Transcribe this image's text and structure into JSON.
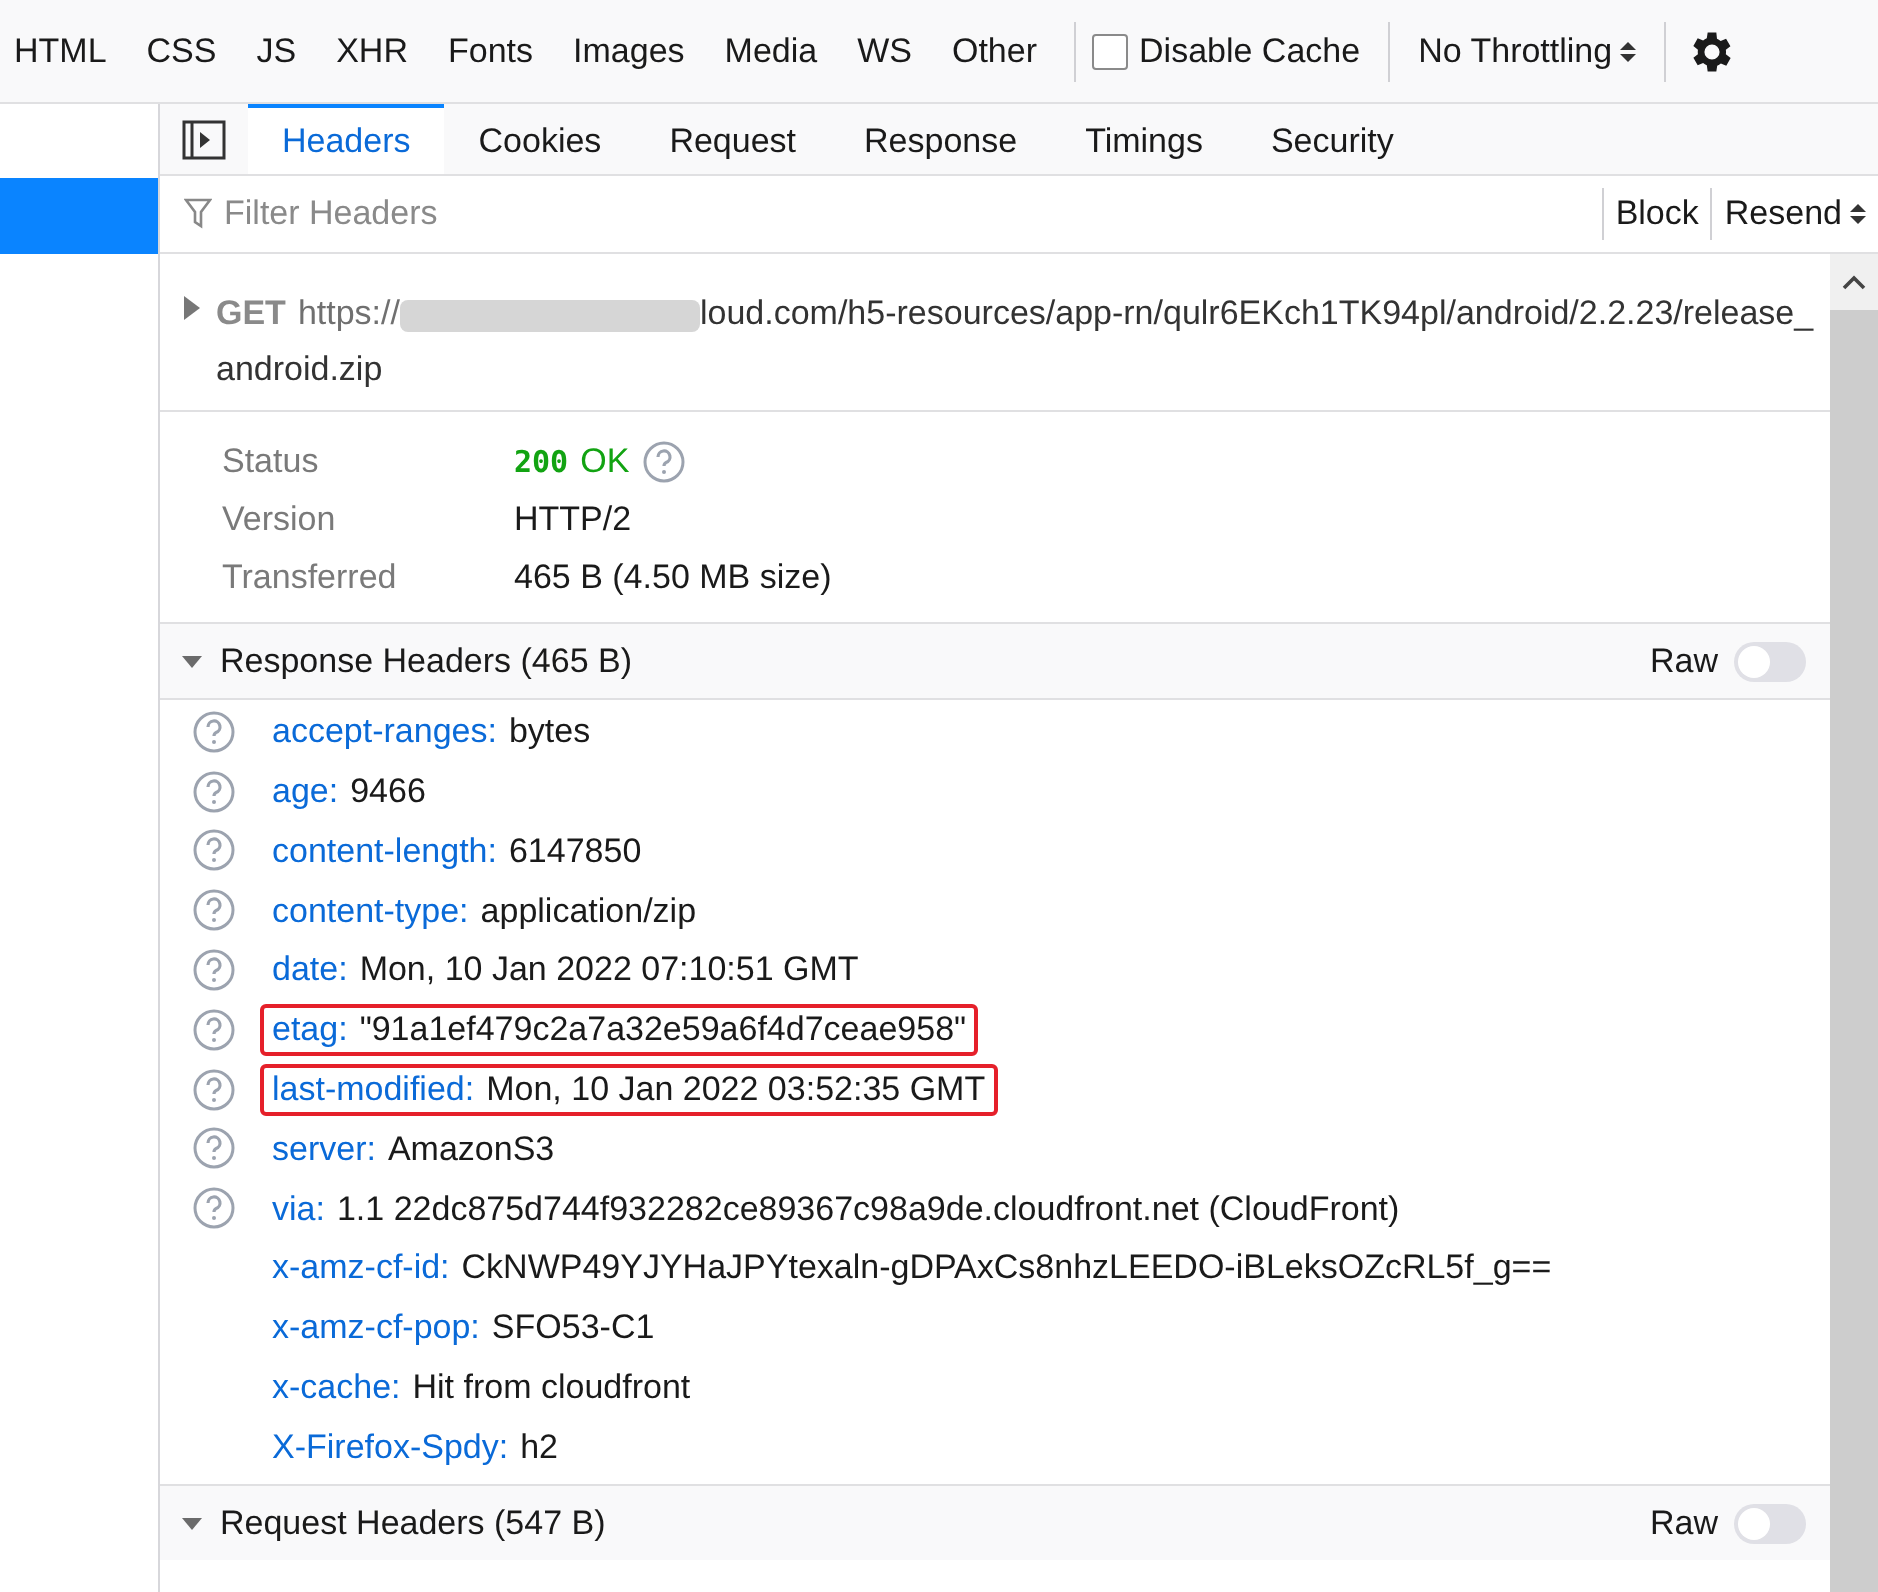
{
  "toolbar": {
    "filters": [
      {
        "label": "HTML",
        "selected": false
      },
      {
        "label": "CSS",
        "selected": false
      },
      {
        "label": "JS",
        "selected": false
      },
      {
        "label": "XHR",
        "selected": false
      },
      {
        "label": "Fonts",
        "selected": false
      },
      {
        "label": "Images",
        "selected": false
      },
      {
        "label": "Media",
        "selected": false
      },
      {
        "label": "WS",
        "selected": false
      },
      {
        "label": "Other",
        "selected": false
      }
    ],
    "disable_cache": {
      "label": "Disable Cache",
      "checked": false
    },
    "throttling": "No Throttling"
  },
  "sidebar": {
    "items": [
      {
        "selected": true
      }
    ]
  },
  "tabs": [
    {
      "label": "Headers",
      "selected": true
    },
    {
      "label": "Cookies",
      "selected": false
    },
    {
      "label": "Request",
      "selected": false
    },
    {
      "label": "Response",
      "selected": false
    },
    {
      "label": "Timings",
      "selected": false
    },
    {
      "label": "Security",
      "selected": false
    }
  ],
  "filter": {
    "placeholder": "Filter Headers",
    "block": "Block",
    "resend": "Resend"
  },
  "request": {
    "method": "GET",
    "url_start": "https://",
    "url_rest": "loud.com/h5-resources/app-rn/qulr6EKch1TK94pl/android/2.2.23/release_android.zip"
  },
  "summary": [
    {
      "label": "Status",
      "value": "OK",
      "code": "200",
      "kind": "status"
    },
    {
      "label": "Version",
      "value": "HTTP/2",
      "kind": "plain"
    },
    {
      "label": "Transferred",
      "value": "465 B (4.50 MB size)",
      "kind": "plain"
    }
  ],
  "response_headers": {
    "title": "Response Headers (465 B)",
    "expanded": true,
    "raw_label": "Raw",
    "raw_on": false,
    "rows": [
      {
        "name": "accept-ranges:",
        "value": "bytes",
        "help": true,
        "highlighted": false
      },
      {
        "name": "age:",
        "value": "9466",
        "help": true,
        "highlighted": false
      },
      {
        "name": "content-length:",
        "value": "6147850",
        "help": true,
        "highlighted": false
      },
      {
        "name": "content-type:",
        "value": "application/zip",
        "help": true,
        "highlighted": false
      },
      {
        "name": "date:",
        "value": "Mon, 10 Jan 2022 07:10:51 GMT",
        "help": true,
        "highlighted": false
      },
      {
        "name": "etag:",
        "value": "\"91a1ef479c2a7a32e59a6f4d7ceae958\"",
        "help": true,
        "highlighted": true
      },
      {
        "name": "last-modified:",
        "value": "Mon, 10 Jan 2022 03:52:35 GMT",
        "help": true,
        "highlighted": true
      },
      {
        "name": "server:",
        "value": "AmazonS3",
        "help": true,
        "highlighted": false
      },
      {
        "name": "via:",
        "value": "1.1 22dc875d744f932282ce89367c98a9de.cloudfront.net (CloudFront)",
        "help": true,
        "highlighted": false
      },
      {
        "name": "x-amz-cf-id:",
        "value": "CkNWP49YJYHaJPYtexaln-gDPAxCs8nhzLEEDO-iBLeksOZcRL5f_g==",
        "help": false,
        "highlighted": false
      },
      {
        "name": "x-amz-cf-pop:",
        "value": "SFO53-C1",
        "help": false,
        "highlighted": false
      },
      {
        "name": "x-cache:",
        "value": "Hit from cloudfront",
        "help": false,
        "highlighted": false
      },
      {
        "name": "X-Firefox-Spdy:",
        "value": "h2",
        "help": false,
        "highlighted": false
      }
    ]
  },
  "request_headers": {
    "title": "Request Headers (547 B)",
    "expanded": true,
    "raw_label": "Raw",
    "raw_on": false
  }
}
